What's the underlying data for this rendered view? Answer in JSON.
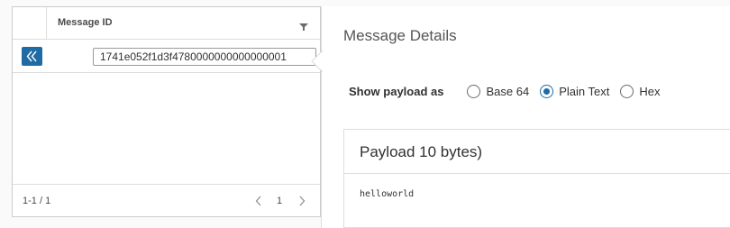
{
  "grid": {
    "column_title": "Message ID",
    "row": {
      "message_id": "1741e052f1d3f4780000000000000001"
    },
    "footer": {
      "count": "1-1 / 1",
      "page": "1"
    }
  },
  "details": {
    "title": "Message Details",
    "payload_format": {
      "label": "Show payload as",
      "options": [
        {
          "label": "Base 64",
          "checked": false
        },
        {
          "label": "Plain Text",
          "checked": true
        },
        {
          "label": "Hex",
          "checked": false
        }
      ]
    },
    "payload": {
      "title": "Payload 10 bytes)",
      "content": "helloworld"
    }
  },
  "colors": {
    "accent": "#1f6ba3",
    "border": "#dddddd"
  },
  "icons": {
    "collapse": "double-chevron-left-icon",
    "filter": "filter-icon",
    "prev": "chevron-left-icon",
    "next": "chevron-right-icon"
  }
}
